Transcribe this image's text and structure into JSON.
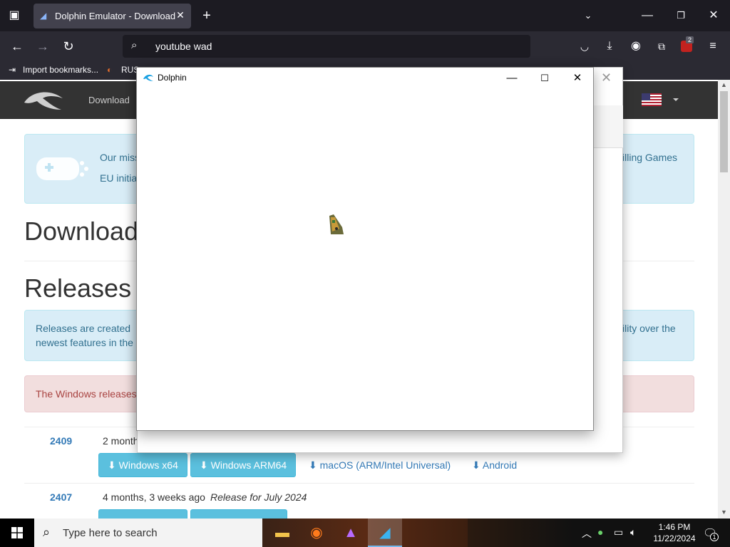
{
  "browser": {
    "tab_title": "Dolphin Emulator - Download",
    "url": "youtube wad",
    "bookmarks": [
      "Import bookmarks...",
      "RUS"
    ],
    "extension_badge": "2"
  },
  "site": {
    "nav_download": "Download",
    "mission_line1": "Our miss",
    "mission_line1_end": "illing Games",
    "mission_line2": "EU initia",
    "heading_download": "Download",
    "heading_releases": "Releases",
    "releases_info_line1": "Releases are created",
    "releases_info_line1_end": "ility over the",
    "releases_info_line2": "newest features in the",
    "windows_warning": "The Windows releases",
    "releases": [
      {
        "version": "2409",
        "age": "2 month",
        "buttons": [
          "Windows x64",
          "Windows ARM64"
        ],
        "links": [
          "macOS (ARM/Intel Universal)",
          "Android"
        ]
      },
      {
        "version": "2407",
        "age": "4 months, 3 weeks ago",
        "note": "Release for July 2024"
      }
    ]
  },
  "dolphin_window": {
    "title": "Dolphin"
  },
  "taskbar": {
    "search_placeholder": "Type here to search",
    "time": "1:46 PM",
    "date": "11/22/2024",
    "notification_count": "1"
  }
}
